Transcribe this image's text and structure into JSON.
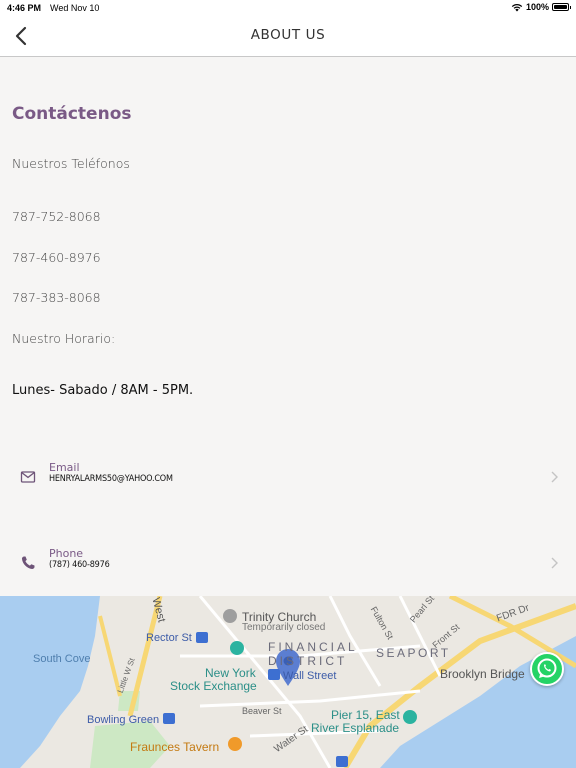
{
  "status": {
    "time": "4:46 PM",
    "date": "Wed Nov 10",
    "battery": "100%"
  },
  "nav": {
    "title": "ABOUT US"
  },
  "contact": {
    "heading": "Contáctenos",
    "phones_label": "Nuestros Teléfonos",
    "phones": [
      "787-752-8068",
      "787-460-8976",
      "787-383-8068"
    ],
    "hours_label": "Nuestro Horario:",
    "hours": "Lunes- Sabado / 8AM - 5PM."
  },
  "rows": [
    {
      "label": "Email",
      "value": "HENRYALARMS50@YAHOO.COM",
      "icon": "mail-icon"
    },
    {
      "label": "Phone",
      "value": "(787) 460-8976",
      "icon": "phone-icon"
    }
  ],
  "map": {
    "labels": {
      "trinity": "Trinity Church",
      "trinity_sub": "Temporarily closed",
      "rector": "Rector St",
      "financial": "FINANCIAL",
      "district": "DISTRICT",
      "seaport": "SEAPORT",
      "nyse1": "New York",
      "nyse2": "Stock Exchange",
      "wallst": "Wall Street",
      "south_cove": "South Cove",
      "brooklyn_bridge": "Brooklyn Bridge",
      "bowling_green": "Bowling Green",
      "fraunces": "Fraunces Tavern",
      "pier15a": "Pier 15, East",
      "pier15b": "River Esplanade",
      "fdr": "FDR Dr",
      "pearl": "Pearl St",
      "fulton": "Fulton St",
      "front": "Front St",
      "beaver": "Beaver St",
      "water": "Water St",
      "west": "West",
      "little_w": "Little W St"
    },
    "colors": {
      "water": "#a9cdf0",
      "land": "#ebe8e2",
      "road": "#f7d774",
      "park": "#cde8c4",
      "pin": "#5b7ed1"
    }
  },
  "colors": {
    "accent": "#7a5a86",
    "whatsapp": "#25d366"
  }
}
